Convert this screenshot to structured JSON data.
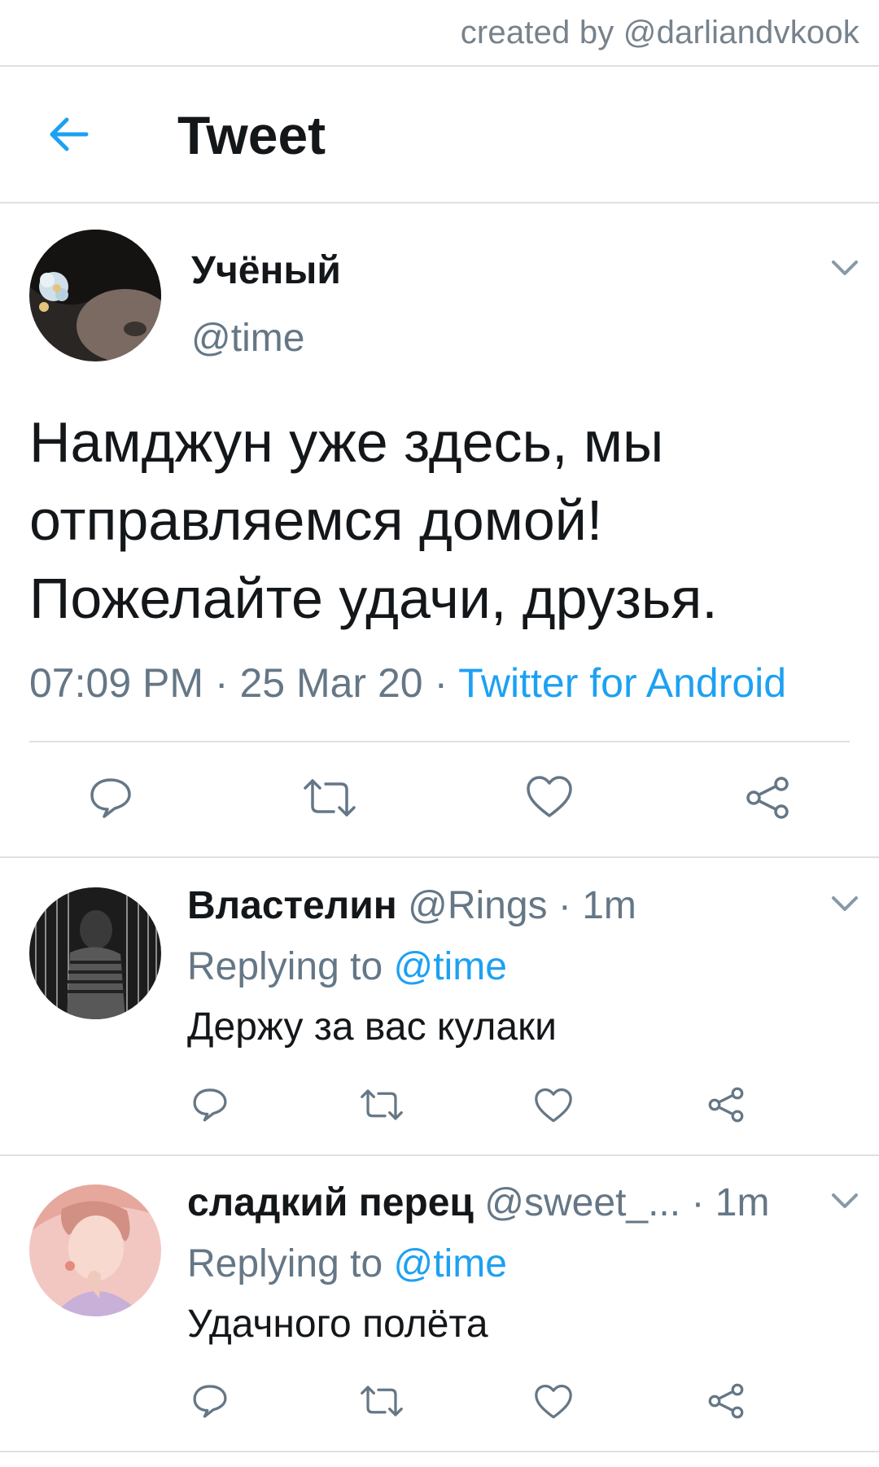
{
  "watermark": "created by @darliandvkook",
  "header": {
    "title": "Tweet"
  },
  "tweet": {
    "name": "Учёный",
    "handle": "@time",
    "text_lines": [
      "Намджун уже здесь, мы",
      "отправляемся домой!",
      "Пожелайте удачи, друзья."
    ],
    "time": "07:09 PM",
    "sep1": " · ",
    "date": "25 Mar 20",
    "sep2": " · ",
    "source": "Twitter for Android"
  },
  "replies": [
    {
      "name": "Властелин",
      "handle": "@Rings",
      "time_sep": " · ",
      "time": "1m",
      "replying_prefix": "Replying to ",
      "replying_to": "@time",
      "text": "Держу за вас кулаки"
    },
    {
      "name": "сладкий перец",
      "handle": "@sweet_...",
      "time_sep": " · ",
      "time": "1m",
      "replying_prefix": "Replying to ",
      "replying_to": "@time",
      "text": "Удачного полёта"
    }
  ],
  "icons": {
    "back": "arrow-left-icon",
    "reply": "reply-bubble-icon",
    "retweet": "retweet-icon",
    "like": "heart-icon",
    "share": "share-icon",
    "more": "chevron-down-icon"
  },
  "colors": {
    "accent": "#1da1f2",
    "text_primary": "#14171a",
    "text_secondary": "#657786",
    "divider": "#dde1e5"
  }
}
